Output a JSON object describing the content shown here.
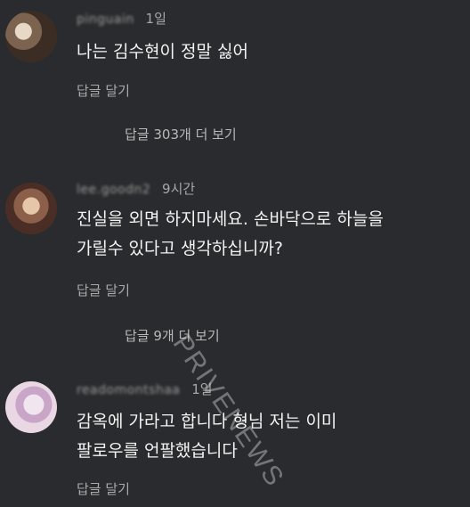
{
  "comments": [
    {
      "username": "pinguain",
      "time": "1일",
      "lines": [
        "나는 김수현이 정말 싫어"
      ],
      "reply_label": "답글 달기"
    },
    {
      "username": "lee.goodn2",
      "time": "9시간",
      "lines": [
        "진실을 외면 하지마세요. 손바닥으로 하늘을",
        "가릴수 있다고 생각하십니까?"
      ],
      "reply_label": "답글 달기"
    },
    {
      "username": "readomontshaa",
      "time": "1일",
      "lines": [
        "감옥에 가라고 합니다 형님 저는 이미",
        "팔로우를 언팔했습니다"
      ],
      "reply_label": "답글 달기"
    }
  ],
  "view_more": [
    "답글 303개 더 보기",
    "답글 9개 더 보기"
  ],
  "watermark": "PRIVENEWS"
}
